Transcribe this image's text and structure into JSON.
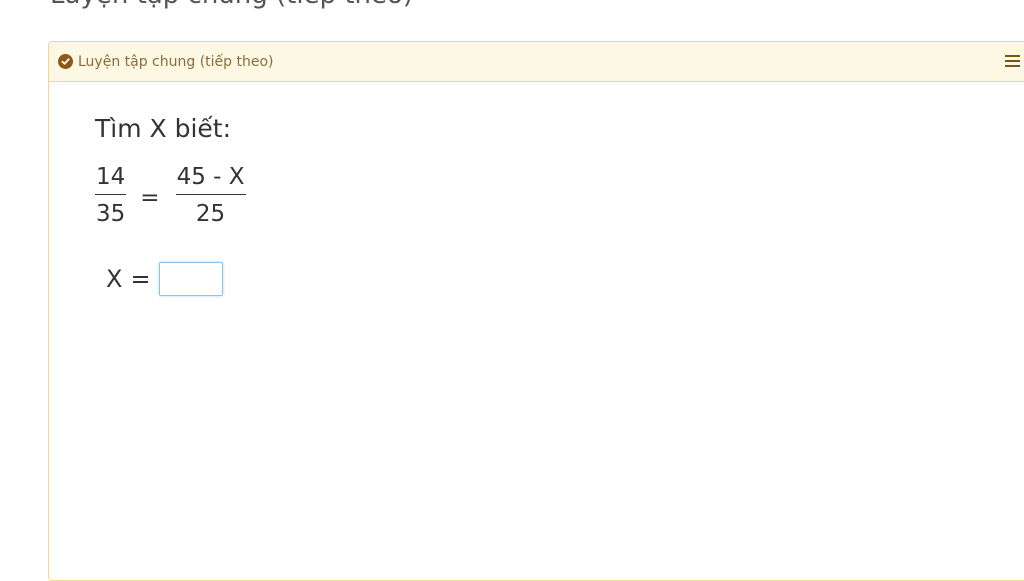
{
  "page": {
    "heading": "Luyện tập chung (tiếp theo)"
  },
  "panel": {
    "title": "Luyện tập chung (tiếp theo)",
    "icon": "check-circle-icon",
    "menu_icon": "hamburger-menu-icon",
    "colors": {
      "header_bg": "#fcf8e3",
      "border": "#f3d68b",
      "title_text": "#8a6d3b"
    }
  },
  "question": {
    "prompt": "Tìm X biết:",
    "left_fraction": {
      "numerator": "14",
      "denominator": "35"
    },
    "equals": "=",
    "right_fraction": {
      "numerator": "45 - X",
      "denominator": "25"
    },
    "answer_label": "X",
    "answer_equals": "=",
    "answer_value": ""
  }
}
